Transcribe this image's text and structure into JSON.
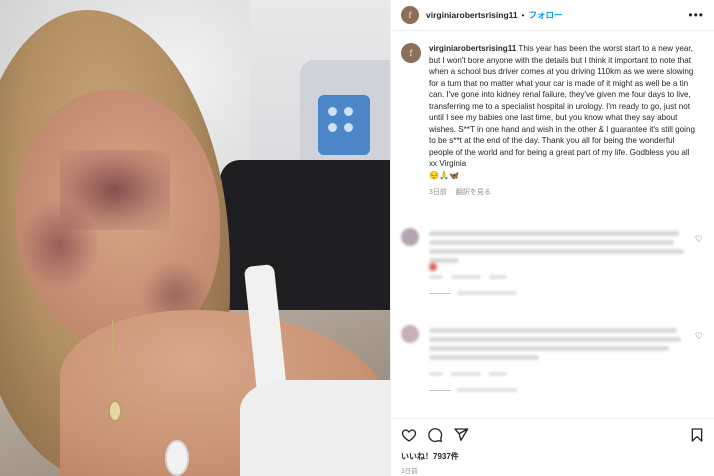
{
  "post": {
    "username": "virginiarobertsrising11",
    "follow_label": "フォロー",
    "separator": "•",
    "more_label": "•••",
    "avatar_letter": "f"
  },
  "caption": {
    "username": "virginiarobertsrising11",
    "text": "This year has been the worst start to a new year, but I won't bore anyone with the details but I think it important to note that when a school bus driver comes at you driving 110km as we were slowing for a turn that no matter what your car is made of it might as well be a tin can. I've gone into kidney renal failure, they've given me four days to live, transferring me to a specialist hospital in urology. I'm ready to go, just not until I see my babies one last time, but you know what they say about wishes. S**T in one hand and wish in the other & I guarantee it's still going to be s**t at the end of the day. Thank you all for being the wonderful people of the world and for being a great part of my life. Godbless you all xx Virginia",
    "emojis": "😔🙏🦋",
    "age": "3日前",
    "translate_label": "翻訳を見る"
  },
  "footer": {
    "likes_label": "いいね！7937件",
    "date": "3日前"
  },
  "icons": [
    "heart-icon",
    "comment-icon",
    "share-icon",
    "bookmark-icon",
    "more-icon"
  ],
  "colors": {
    "link": "#0095f6",
    "text": "#262626",
    "muted": "#8e8e8e"
  }
}
